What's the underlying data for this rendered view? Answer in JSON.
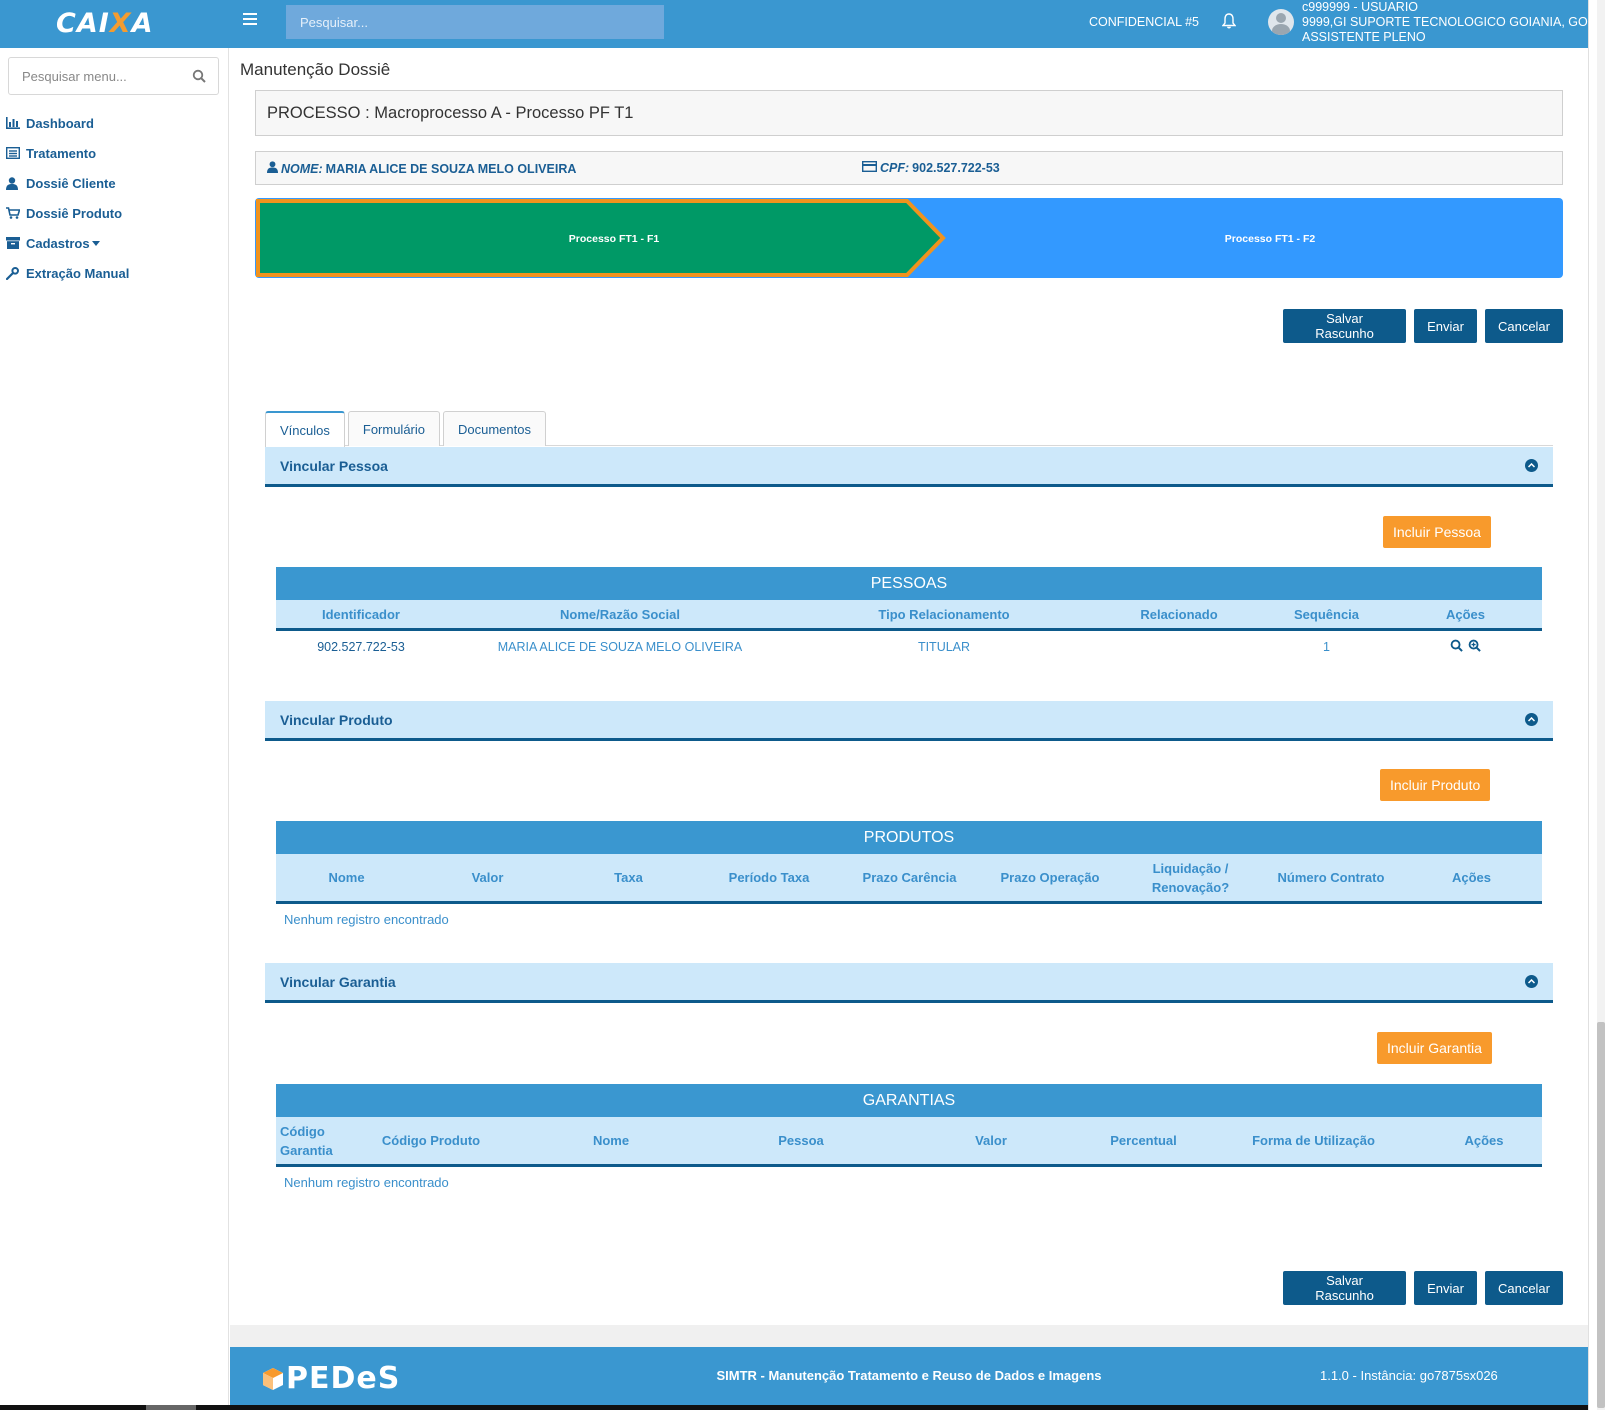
{
  "topbar": {
    "logo": "CAIXA",
    "search_placeholder": "Pesquisar...",
    "confidencial": "CONFIDENCIAL #5",
    "user_line1": "c999999 - USUARIO",
    "user_line2": "9999,GI SUPORTE TECNOLOGICO GOIANIA, GO",
    "user_line3": "ASSISTENTE PLENO"
  },
  "sidebar": {
    "search_placeholder": "Pesquisar menu...",
    "items": [
      {
        "label": "Dashboard",
        "icon": "bar-chart-icon"
      },
      {
        "label": "Tratamento",
        "icon": "list-icon"
      },
      {
        "label": "Dossiê Cliente",
        "icon": "user-icon"
      },
      {
        "label": "Dossiê Produto",
        "icon": "cart-icon"
      },
      {
        "label": "Cadastros",
        "icon": "archive-icon"
      },
      {
        "label": "Extração Manual",
        "icon": "wrench-icon"
      }
    ]
  },
  "main": {
    "title": "Manutenção Dossiê",
    "processo": "PROCESSO : Macroprocesso A - Processo PF T1",
    "cliente": {
      "nome_label": "NOME:",
      "nome": "MARIA ALICE DE SOUZA MELO OLIVEIRA",
      "cpf_label": "CPF:",
      "cpf": "902.527.722-53"
    },
    "steps": [
      "Processo FT1 - F1",
      "Processo FT1 - F2"
    ],
    "actions": {
      "salvar": "Salvar Rascunho",
      "enviar": "Enviar",
      "cancelar": "Cancelar"
    },
    "tabs": [
      "Vínculos",
      "Formulário",
      "Documentos"
    ],
    "pessoa": {
      "section": "Vincular Pessoa",
      "button": "Incluir Pessoa",
      "table_title": "PESSOAS",
      "headers": [
        "Identificador",
        "Nome/Razão Social",
        "Tipo Relacionamento",
        "Relacionado",
        "Sequência",
        "Ações"
      ],
      "rows": [
        {
          "identificador": "902.527.722-53",
          "nome": "MARIA ALICE DE SOUZA MELO OLIVEIRA",
          "tipo": "TITULAR",
          "relacionado": "",
          "sequencia": "1"
        }
      ]
    },
    "produto": {
      "section": "Vincular Produto",
      "button": "Incluir Produto",
      "table_title": "PRODUTOS",
      "headers": [
        "Nome",
        "Valor",
        "Taxa",
        "Período Taxa",
        "Prazo Carência",
        "Prazo Operação",
        "Liquidação / Renovação?",
        "Número Contrato",
        "Ações"
      ],
      "empty": "Nenhum registro encontrado"
    },
    "garantia": {
      "section": "Vincular Garantia",
      "button": "Incluir Garantia",
      "table_title": "GARANTIAS",
      "headers": [
        "Código Garantia",
        "Código Produto",
        "Nome",
        "Pessoa",
        "Valor",
        "Percentual",
        "Forma de Utilização",
        "Ações"
      ],
      "empty": "Nenhum registro encontrado"
    }
  },
  "footer": {
    "logo": "PEDeS",
    "center": "SIMTR - Manutenção Tratamento e Reuso de Dados e Imagens",
    "version": "1.1.0 - Instância: go7875sx026"
  },
  "colors": {
    "primary": "#3a97d0",
    "dark": "#0d5a8b",
    "accent": "#f89a2c",
    "step_active": "#009966",
    "step_next": "#3399ff"
  }
}
